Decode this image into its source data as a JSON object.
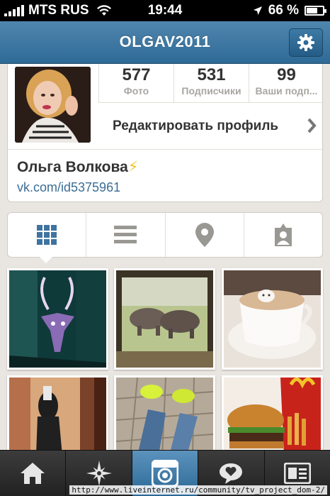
{
  "status_bar": {
    "carrier": "MTS RUS",
    "time": "19:44",
    "battery": "66 %",
    "battery_level": 0.66
  },
  "nav": {
    "title": "OLGAV2011",
    "settings_icon": "gear-icon"
  },
  "profile": {
    "stats": [
      {
        "value": "577",
        "label": "Фото"
      },
      {
        "value": "531",
        "label": "Подписчики"
      },
      {
        "value": "99",
        "label": "Ваши подп..."
      }
    ],
    "edit_label": "Редактировать профиль",
    "full_name": "Ольга Волкова",
    "name_emoji": "⚡",
    "website": "vk.com/id5375961"
  },
  "view_tabs": [
    {
      "icon": "grid-icon"
    },
    {
      "icon": "list-icon"
    },
    {
      "icon": "location-pin-icon"
    },
    {
      "icon": "tagged-photos-icon"
    }
  ],
  "photos": [
    {
      "subject": "antelope-painting"
    },
    {
      "subject": "rhinos-painting"
    },
    {
      "subject": "coffee-latte-art"
    },
    {
      "subject": "mirror-selfie"
    },
    {
      "subject": "sneakers-feet"
    },
    {
      "subject": "burger-fries"
    }
  ],
  "tab_bar": [
    {
      "icon": "home-icon"
    },
    {
      "icon": "explore-icon"
    },
    {
      "icon": "camera-icon",
      "active": true
    },
    {
      "icon": "news-icon"
    },
    {
      "icon": "profile-card-icon"
    }
  ],
  "overlay_url": "http://www.liveinternet.ru/community/tv_project_dom-2/",
  "colors": {
    "accent": "#2f6a97",
    "link": "#3b6d96",
    "tab_active": "#4a84b1"
  }
}
